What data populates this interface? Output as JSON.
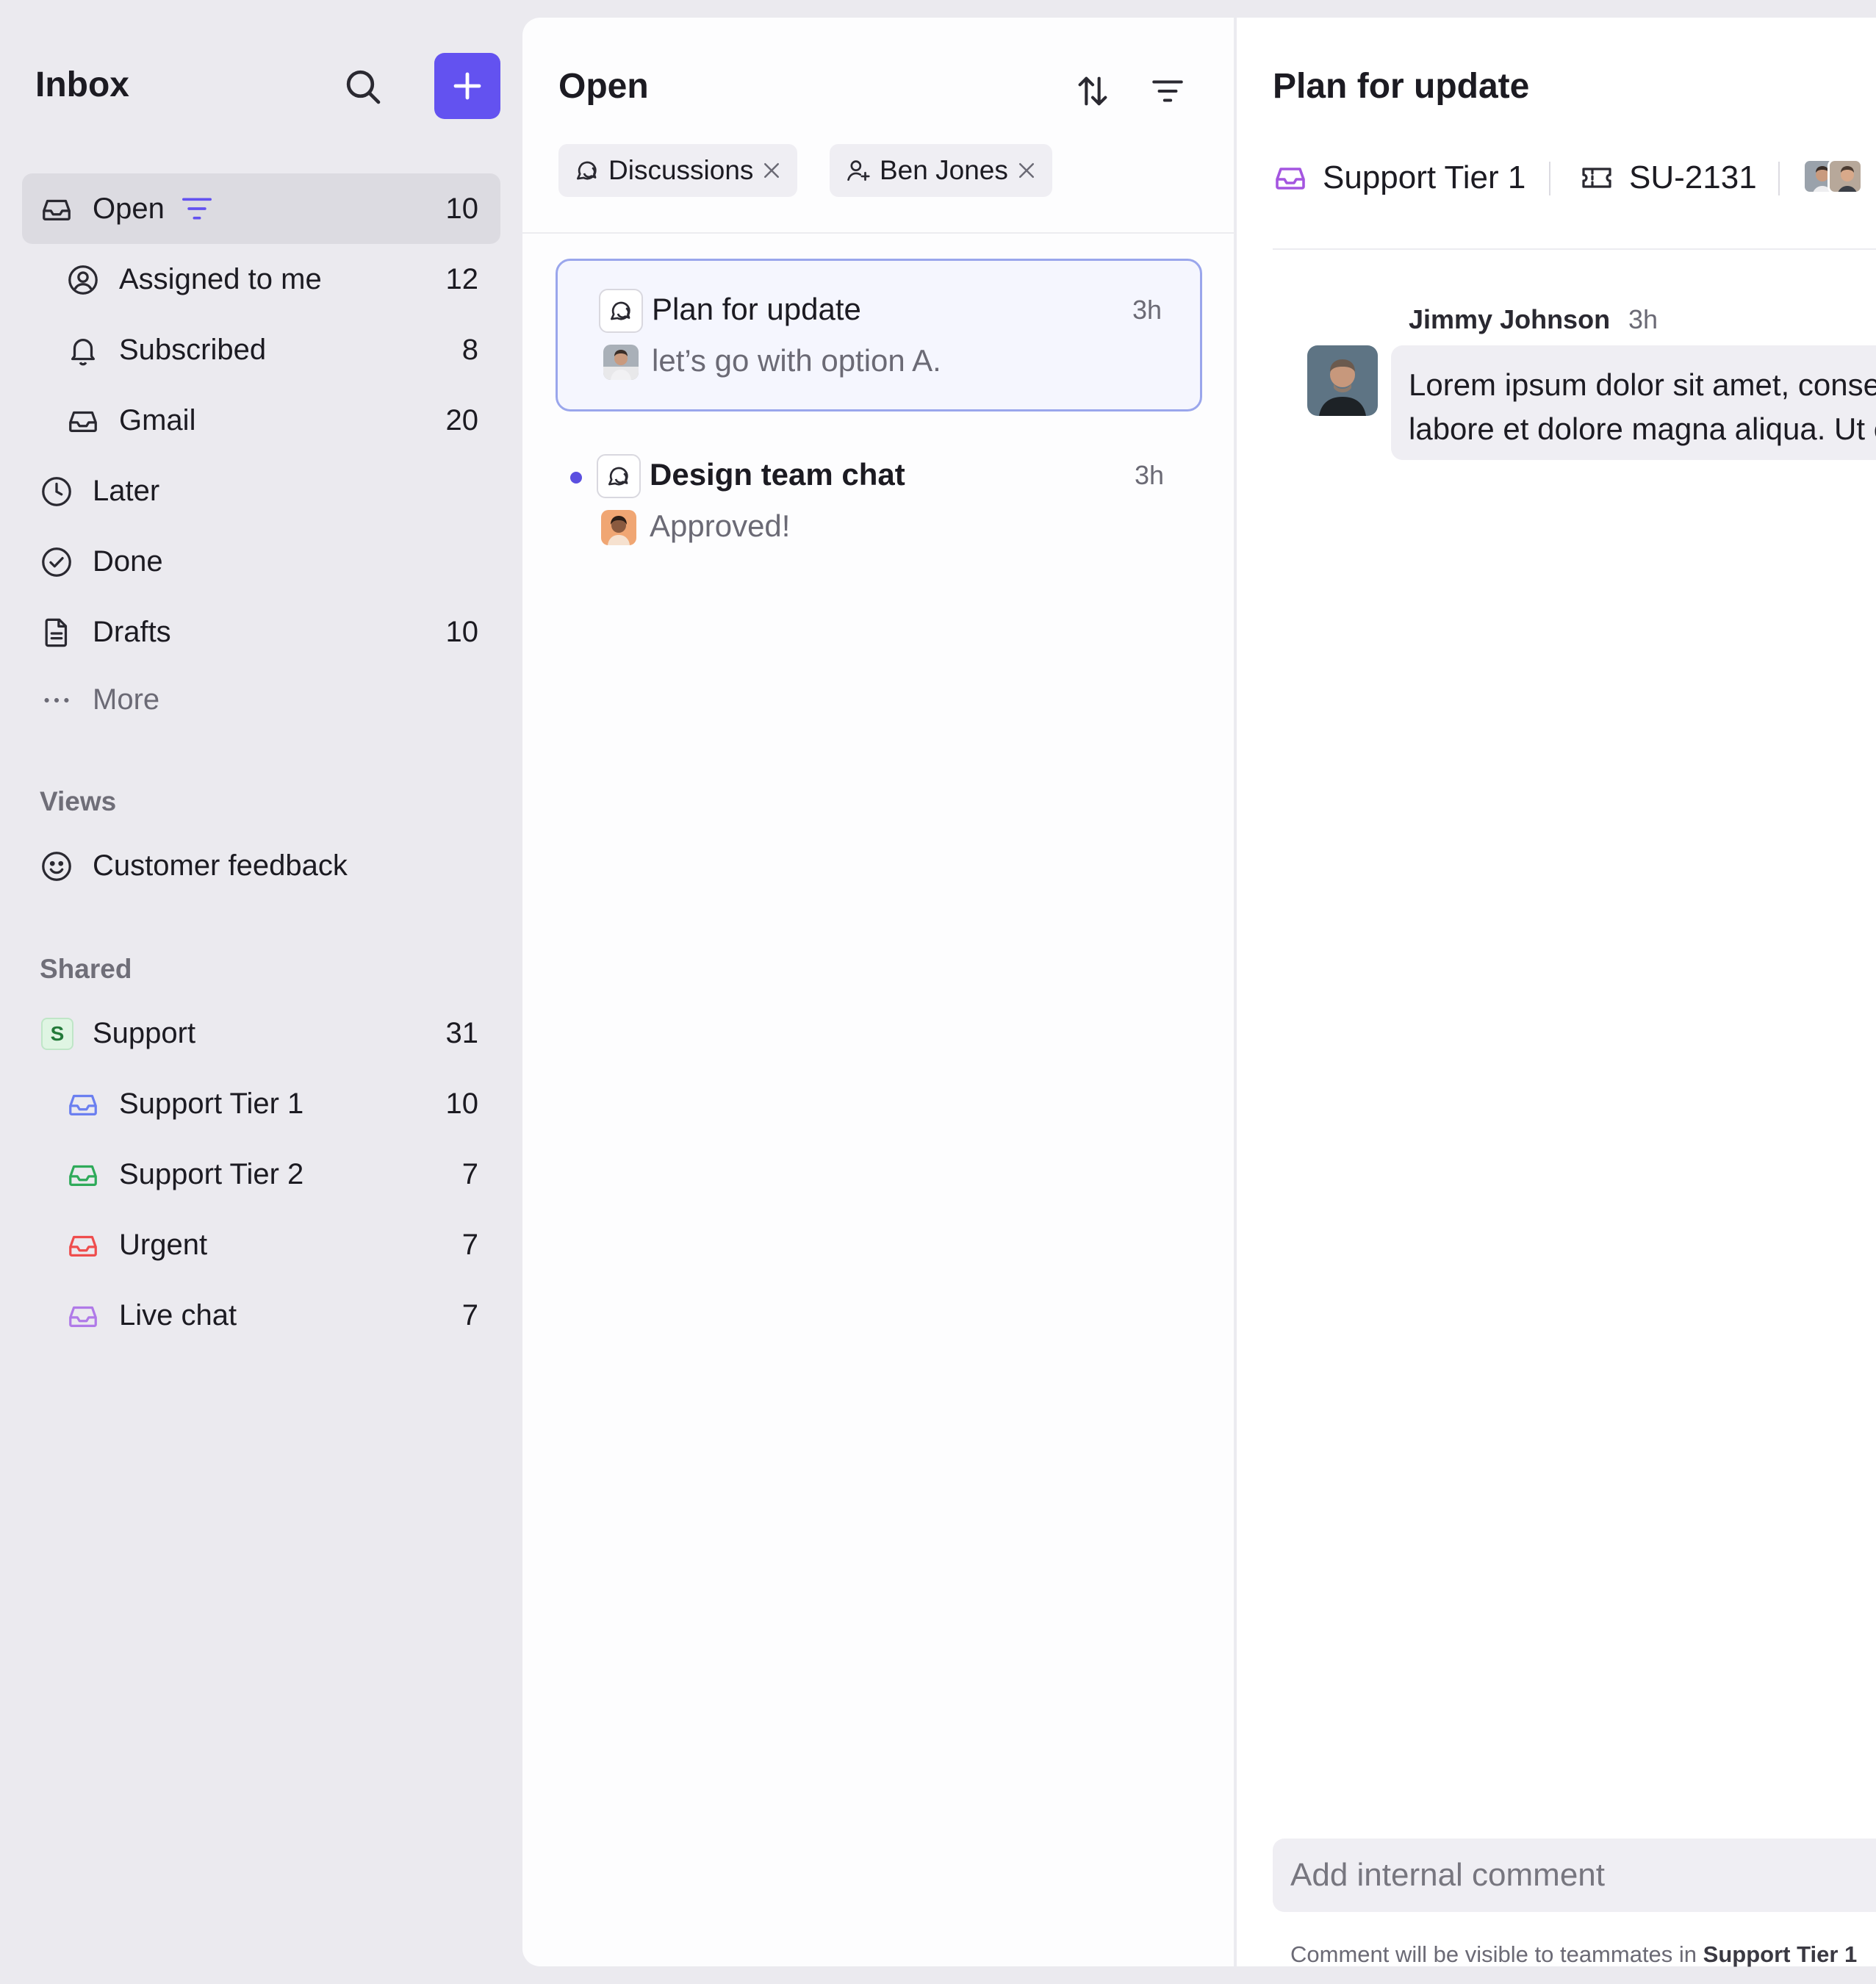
{
  "sidebar": {
    "title": "Inbox",
    "nav": [
      {
        "label": "Open",
        "count": "10"
      },
      {
        "label": "Assigned to me",
        "count": "12"
      },
      {
        "label": "Subscribed",
        "count": "8"
      },
      {
        "label": "Gmail",
        "count": "20"
      },
      {
        "label": "Later",
        "count": ""
      },
      {
        "label": "Done",
        "count": ""
      },
      {
        "label": "Drafts",
        "count": "10"
      },
      {
        "label": "More",
        "count": ""
      }
    ],
    "views_heading": "Views",
    "views": [
      {
        "label": "Customer feedback"
      }
    ],
    "shared_heading": "Shared",
    "shared": [
      {
        "label": "Support",
        "count": "31",
        "badge": "S"
      },
      {
        "label": "Support Tier 1",
        "count": "10",
        "color": "#6b7ff0"
      },
      {
        "label": "Support Tier 2",
        "count": "7",
        "color": "#2faa5a"
      },
      {
        "label": "Urgent",
        "count": "7",
        "color": "#ef4d4d"
      },
      {
        "label": "Live chat",
        "count": "7",
        "color": "#b07ae8"
      }
    ]
  },
  "list": {
    "title": "Open",
    "chips": [
      {
        "label": "Discussions"
      },
      {
        "label": "Ben Jones"
      }
    ],
    "conversations": [
      {
        "title": "Plan for update",
        "time": "3h",
        "preview": "let’s go with option A.",
        "selected": true,
        "unread": false
      },
      {
        "title": "Design team chat",
        "time": "3h",
        "preview": "Approved!",
        "selected": false,
        "unread": true
      }
    ]
  },
  "detail": {
    "title": "Plan for update",
    "inbox": "Support Tier 1",
    "ticket": "SU-2131",
    "message": {
      "author": "Jimmy Johnson",
      "time": "3h",
      "lines": [
        "Lorem ipsum dolor sit amet, consectetur adipiscing elit, sed do eiusmod tempor incididunt ut",
        "labore et dolore magna aliqua. Ut enim ad minim veniam"
      ]
    },
    "comment": {
      "placeholder": "Add internal comment",
      "hint_prefix": "Comment will be visible to teammates in",
      "hint_inbox": "Support Tier 1"
    }
  },
  "colors": {
    "accent": "#6352f0",
    "selected_border": "#9aa6ec",
    "inbox_purple": "#a455e0"
  }
}
